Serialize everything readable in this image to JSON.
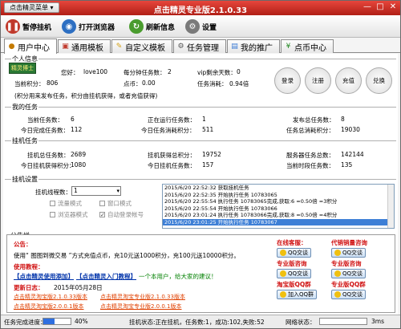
{
  "window": {
    "menu_label": "点击精灵菜单 ▾",
    "title": "点击精灵专业版2.1.0.33",
    "minimize_glyph": "—",
    "maximize_glyph": "□",
    "close_glyph": "✕"
  },
  "toolbar": {
    "pause": "暂停挂机",
    "browser": "打开浏览器",
    "refresh": "刷新信息",
    "settings": "设置"
  },
  "tabs": [
    "用户中心",
    "通用模板",
    "自定义模板",
    "任务管理",
    "我的推广",
    "点币中心"
  ],
  "personal": {
    "group_title": "个人信息",
    "badge": "精灵博士",
    "hello_label": "您好：",
    "username": "love100",
    "hourly_label": "每分钟任务数：",
    "hourly_value": "2",
    "vip_label": "vip剩余天数：",
    "vip_value": "0",
    "points_label": "当前积分：",
    "points_value": "806",
    "coins_label": "点币：",
    "coins_value": "0.00",
    "rate_label": "任务消耗：",
    "rate_value": "0.94倍",
    "note": "(积分用来发布任务，积分由挂机获得，或者充值获得)",
    "buttons": [
      "登录",
      "注册",
      "充值",
      "兑换"
    ]
  },
  "mytasks": {
    "group_title": "我的任务",
    "current_label": "当前任务数：",
    "current_value": "6",
    "running_label": "正在运行任务数：",
    "running_value": "1",
    "published_label": "发布总任务数：",
    "published_value": "8",
    "today_done_label": "今日完成任务数：",
    "today_done_value": "112",
    "today_cost_label": "今日任务消耗积分：",
    "today_cost_value": "511",
    "total_cost_label": "任务总消耗积分：",
    "total_cost_value": "19030"
  },
  "hangup": {
    "group_title": "挂机任务",
    "total_label": "挂机总任务数：",
    "total_value": "2689",
    "earned_label": "挂机获得总积分：",
    "earned_value": "19752",
    "server_label": "服务器任务总数：",
    "server_value": "142144",
    "today_earned_label": "今日挂机获得积分：",
    "today_earned_value": "1080",
    "today_tasks_label": "今日挂机任务数：",
    "today_tasks_value": "157",
    "current_hour_label": "当前时段任务数：",
    "current_hour_value": "135"
  },
  "hangup_settings": {
    "group_title": "挂机设置",
    "threads_label": "挂机线程数：",
    "threads_value": "1",
    "options": [
      {
        "label": "流量模式",
        "checked": false
      },
      {
        "label": "窗口模式",
        "checked": false
      },
      {
        "label": "浏览器模式",
        "checked": false
      },
      {
        "label": "自动登录帐号",
        "checked": true
      }
    ],
    "log": [
      "2015/6/20 22:52:32 获取挂机任务",
      "2015/6/20 22:52:35 开始执行任务 10783065",
      "2015/6/20 22:55:54 执行任务 10783065完成,获取:6 =0.50倍 =3积分",
      "2015/6/20 22:55:54 开始执行任务 10783066",
      "2015/6/20 23:01:24 执行任务 10783066完成,获取:8 =0.50倍 =4积分",
      "2015/6/20 23:01:25 开始执行任务 10783067"
    ],
    "selected_log": 5
  },
  "notice": {
    "group_title": "公告栏",
    "heading": "公告：",
    "line1": "使用“ 图图到微交易 ”方式充值点币，充10元送1000积分，充100元送10000积分。",
    "tutorial_label": "使用教程：",
    "tutorial_link1": "【点击精灵使用添加】",
    "tutorial_link2": "【点击精灵入门教程】",
    "tutorial_tip": "一个本用户，给大家的建议！",
    "update_label": "更新日志：",
    "update_date": "2015年05月28日",
    "versions": [
      "点击精灵淘宝版2.1.0.33版本",
      "点击精灵淘宝专业版2.1.0.33版本",
      "点击精灵淘宝版2.0.0.1版本",
      "点击精灵淘宝专业版2.0.0.1版本"
    ],
    "online_service": "在线客服：",
    "agent_service": "代销销量咨询",
    "pro_consult": "专业版咨询",
    "pro_consult2": "专业版咨询",
    "taobao_qq": "淘宝版QQ群",
    "pro_qq": "专业版QQ群",
    "qq_label": "QQ交谈",
    "join_qq": "加入QQ群"
  },
  "statusbar": {
    "progress_label": "任务完成进度：",
    "progress_value": "40%",
    "progress_fraction": 0.4,
    "state_text": "挂机状态:正在挂机，任务数:1，成功:102,失败:52",
    "network_label": "网络状态：",
    "network_value": "3ms"
  }
}
